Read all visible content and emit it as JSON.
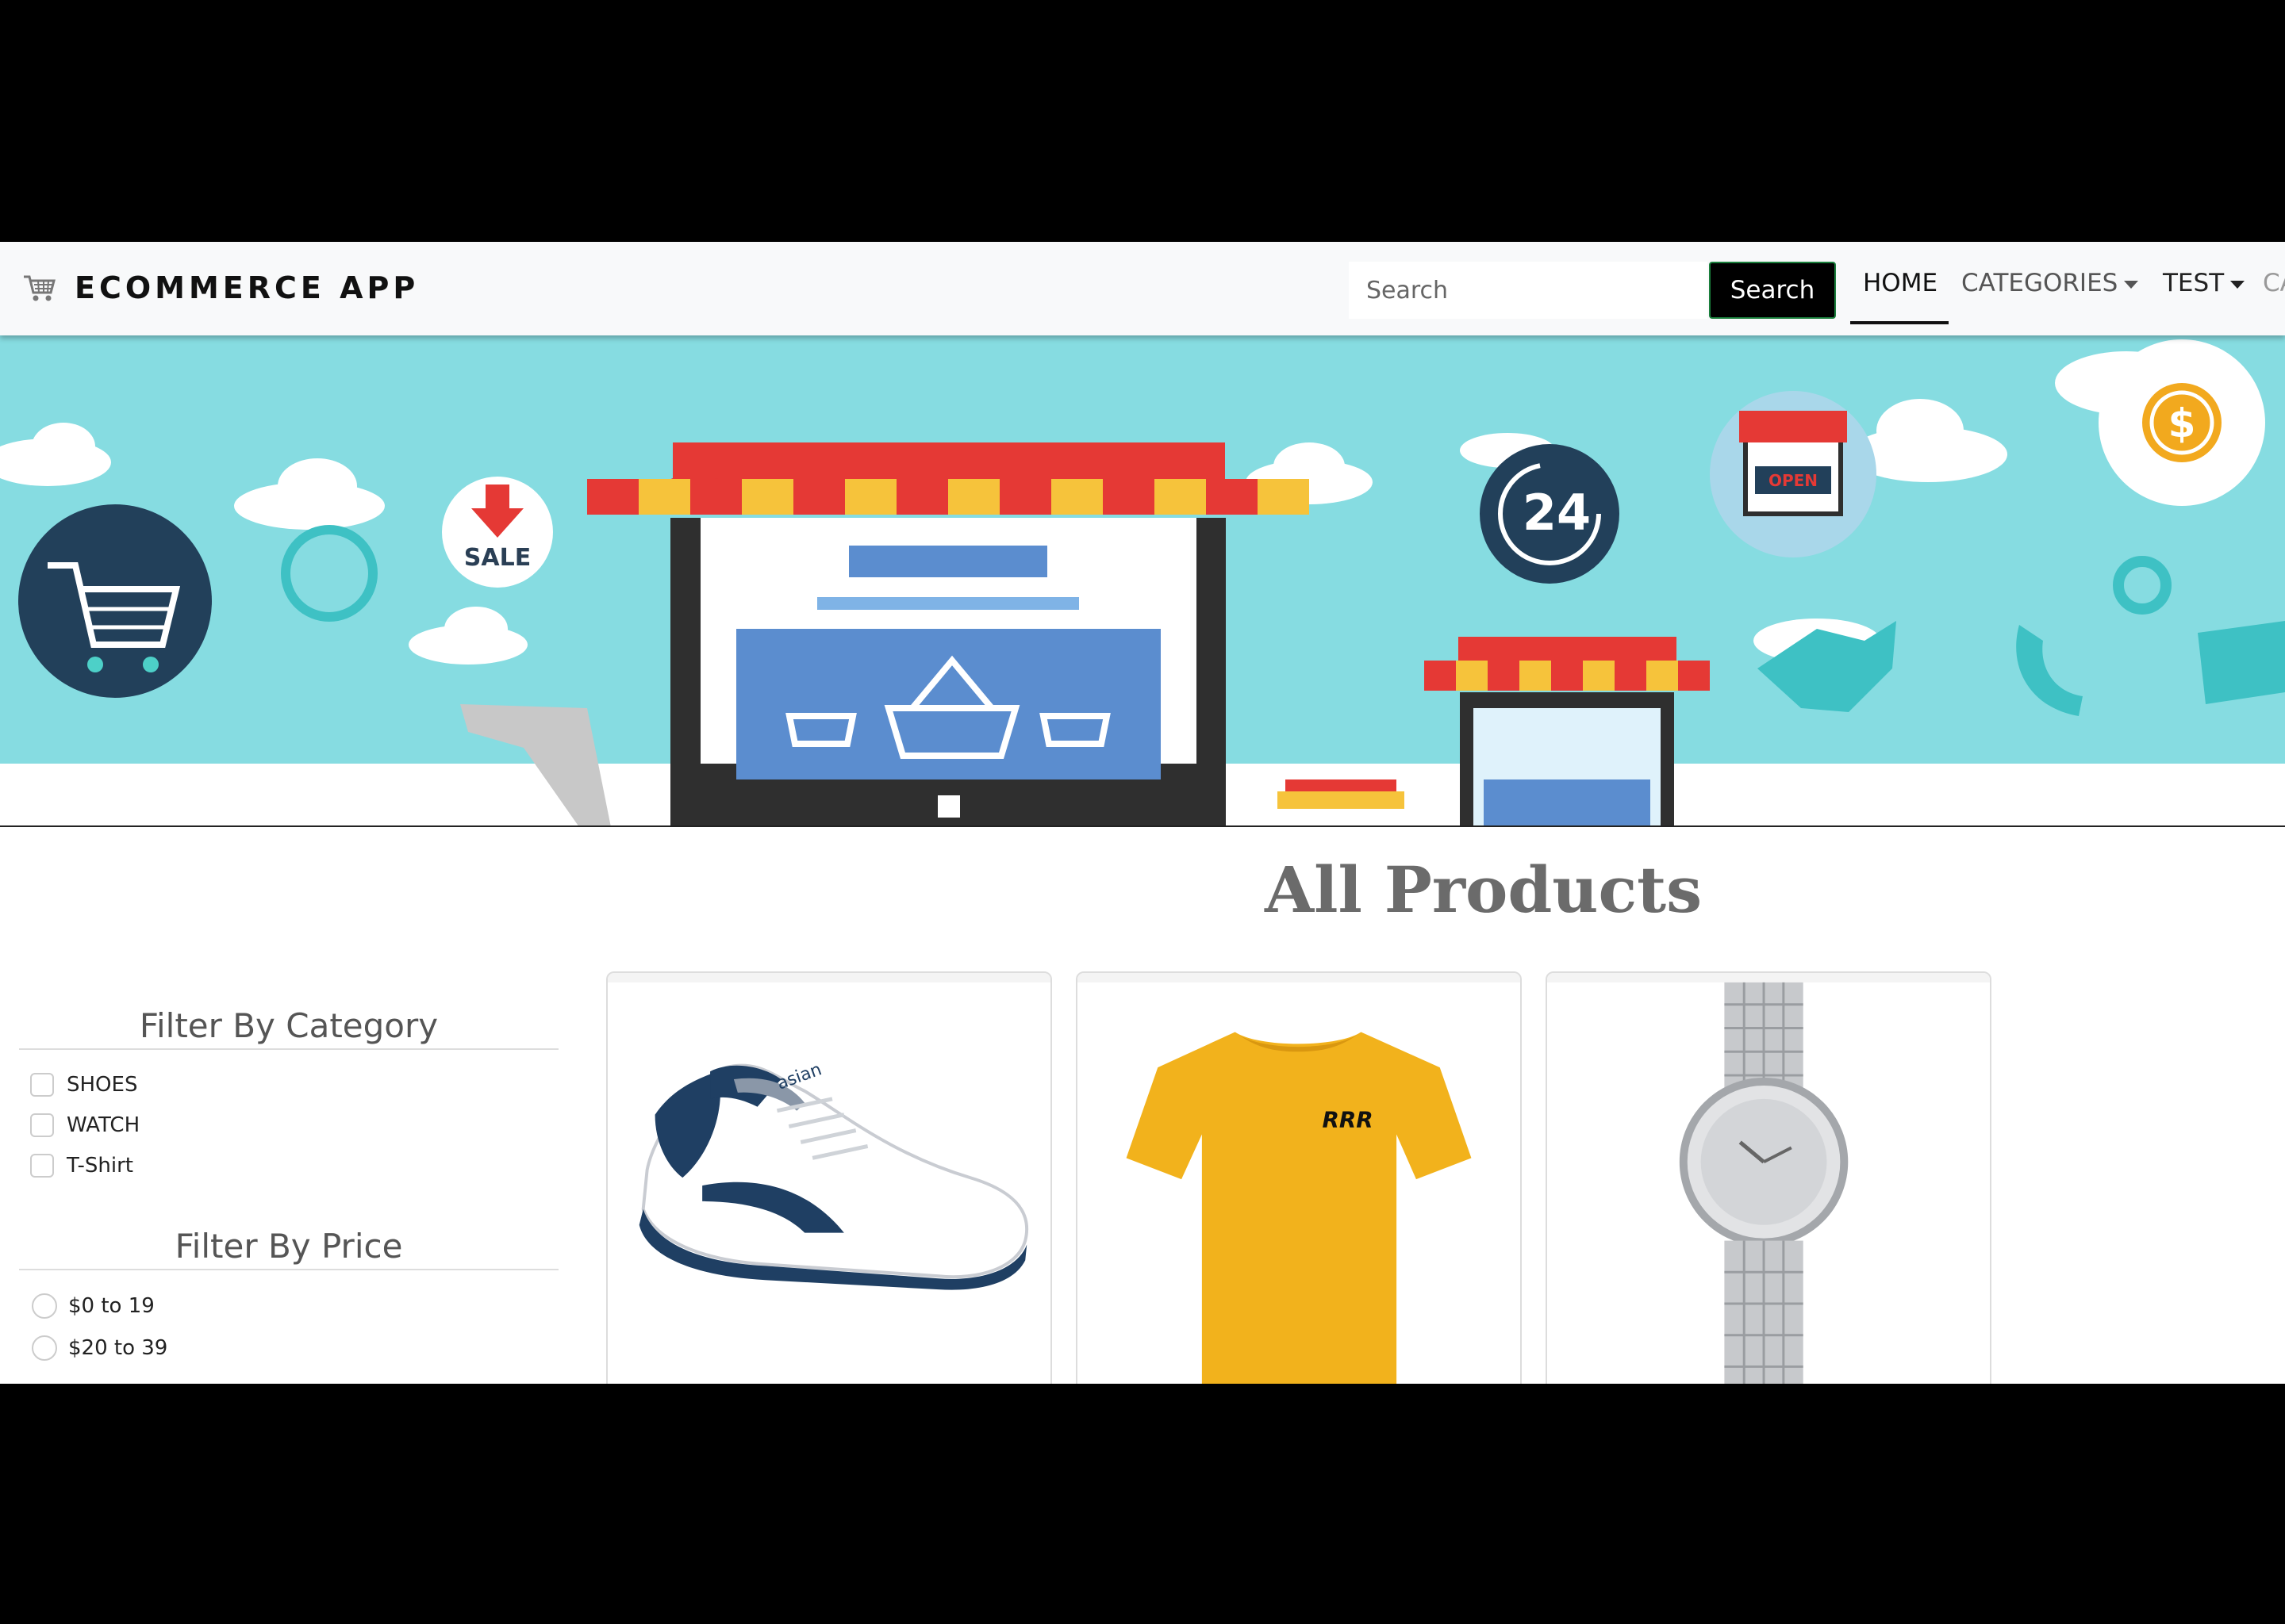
{
  "navbar": {
    "brand": "ECOMMERCE APP",
    "search_placeholder": "Search",
    "search_button": "Search",
    "links": {
      "home": "HOME",
      "categories": "CATEGORIES",
      "test": "TEST",
      "cart": "CA"
    }
  },
  "banner": {
    "sale_text": "SALE",
    "clock_text": "24",
    "open_sign": "OPEN",
    "dollar": "$"
  },
  "main": {
    "title": "All Products"
  },
  "filters": {
    "category_heading": "Filter By Category",
    "categories": [
      "SHOES",
      "WATCH",
      "T-Shirt"
    ],
    "price_heading": "Filter By Price",
    "prices": [
      "$0 to 19",
      "$20 to 39"
    ]
  },
  "products": {
    "tshirt_print": "RRR",
    "shoe_brand": "asian"
  },
  "colors": {
    "navbar_bg": "#f8f9fa",
    "sky": "#86dce1",
    "awning_red": "#e53935",
    "awning_yellow": "#f6c33b",
    "shirt_yellow": "#f2b21c",
    "shoe_navy": "#1f3f63"
  }
}
